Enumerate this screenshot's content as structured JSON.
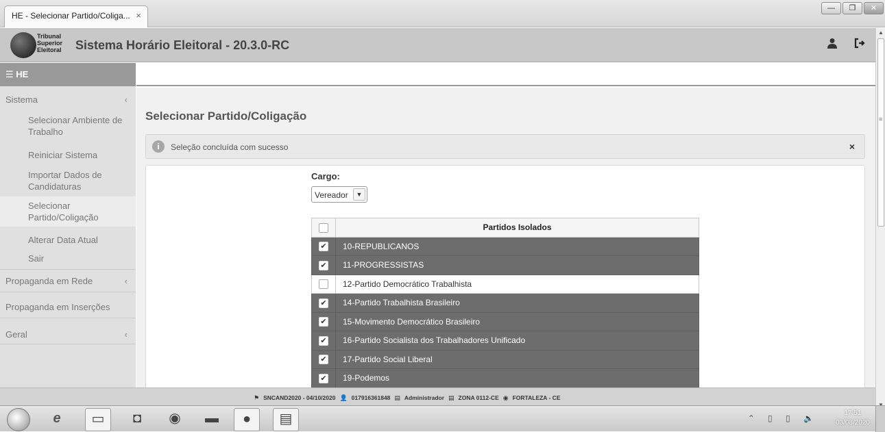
{
  "browser": {
    "tab_title": "HE - Selecionar Partido/Coliga...",
    "tab_close": "×",
    "win_minimize": "—",
    "win_maximize": "❐",
    "win_close": "✕"
  },
  "header": {
    "logo_line1": "Tribunal",
    "logo_line2": "Superior",
    "logo_line3": "Eleitoral",
    "app_title": "Sistema Horário Eleitoral - 20.3.0-RC",
    "user_icon": "user-icon",
    "logout_icon": "logout-icon"
  },
  "sidebar": {
    "menu_label": "☰ HE",
    "sections": [
      {
        "label": "Sistema",
        "caret": "‹"
      },
      {
        "label": "Propaganda em Rede",
        "caret": "‹"
      },
      {
        "label": "Propaganda em Inserções",
        "caret": "‹"
      },
      {
        "label": "Geral",
        "caret": "‹"
      }
    ],
    "items": [
      {
        "line1": "Selecionar Ambiente de",
        "line2": "Trabalho"
      },
      {
        "line1": "Reiniciar Sistema",
        "line2": ""
      },
      {
        "line1": "Importar Dados de",
        "line2": "Candidaturas"
      },
      {
        "line1": "Selecionar",
        "line2": "Partido/Coligação"
      },
      {
        "line1": "Alterar Data Atual",
        "line2": ""
      },
      {
        "line1": "Sair",
        "line2": ""
      }
    ]
  },
  "main": {
    "page_title": "Selecionar Partido/Coligação",
    "alert": {
      "icon": "i",
      "message": "Seleção concluída com sucesso",
      "close": "×"
    },
    "cargo_label": "Cargo:",
    "cargo_value": "Vereador",
    "cargo_arrow": "▼",
    "table": {
      "header": "Partidos Isolados",
      "rows": [
        {
          "name": "10-REPUBLICANOS",
          "checked": true
        },
        {
          "name": "11-PROGRESSISTAS",
          "checked": true
        },
        {
          "name": "12-Partido Democrático Trabalhista",
          "checked": false
        },
        {
          "name": "14-Partido Trabalhista Brasileiro",
          "checked": true
        },
        {
          "name": "15-Movimento Democrático Brasileiro",
          "checked": true
        },
        {
          "name": "16-Partido Socialista dos Trabalhadores Unificado",
          "checked": true
        },
        {
          "name": "17-Partido Social Liberal",
          "checked": true
        },
        {
          "name": "19-Podemos",
          "checked": true
        }
      ]
    }
  },
  "footer": {
    "flag_icon": "⚑",
    "env": "SNCAND2020 - 04/10/2020",
    "user_icon": "👤",
    "user_id": "017916361848",
    "role_icon": "▤",
    "role": "Administrador",
    "zone_icon": "▤",
    "zone": "ZONA 0112-CE",
    "city_icon": "◉",
    "city": "FORTALEZA  -  CE"
  },
  "taskbar": {
    "tray": "⌃ ▯ ▯ 🔈",
    "time": "17:51",
    "date": "03/08/2020"
  }
}
